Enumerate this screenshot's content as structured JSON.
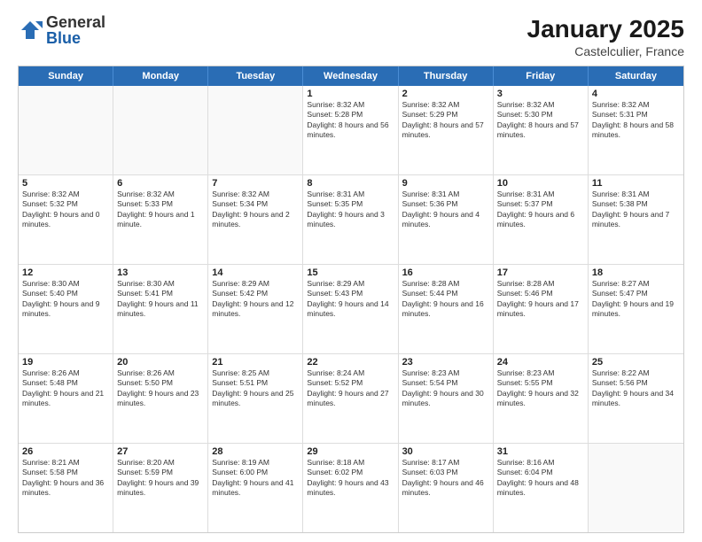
{
  "header": {
    "logo": {
      "general": "General",
      "blue": "Blue"
    },
    "title": "January 2025",
    "location": "Castelculier, France"
  },
  "calendar": {
    "days": [
      "Sunday",
      "Monday",
      "Tuesday",
      "Wednesday",
      "Thursday",
      "Friday",
      "Saturday"
    ],
    "rows": [
      [
        {
          "day": "",
          "empty": true
        },
        {
          "day": "",
          "empty": true
        },
        {
          "day": "",
          "empty": true
        },
        {
          "day": "1",
          "sunrise": "8:32 AM",
          "sunset": "5:28 PM",
          "daylight": "8 hours and 56 minutes."
        },
        {
          "day": "2",
          "sunrise": "8:32 AM",
          "sunset": "5:29 PM",
          "daylight": "8 hours and 57 minutes."
        },
        {
          "day": "3",
          "sunrise": "8:32 AM",
          "sunset": "5:30 PM",
          "daylight": "8 hours and 57 minutes."
        },
        {
          "day": "4",
          "sunrise": "8:32 AM",
          "sunset": "5:31 PM",
          "daylight": "8 hours and 58 minutes."
        }
      ],
      [
        {
          "day": "5",
          "sunrise": "8:32 AM",
          "sunset": "5:32 PM",
          "daylight": "9 hours and 0 minutes."
        },
        {
          "day": "6",
          "sunrise": "8:32 AM",
          "sunset": "5:33 PM",
          "daylight": "9 hours and 1 minute."
        },
        {
          "day": "7",
          "sunrise": "8:32 AM",
          "sunset": "5:34 PM",
          "daylight": "9 hours and 2 minutes."
        },
        {
          "day": "8",
          "sunrise": "8:31 AM",
          "sunset": "5:35 PM",
          "daylight": "9 hours and 3 minutes."
        },
        {
          "day": "9",
          "sunrise": "8:31 AM",
          "sunset": "5:36 PM",
          "daylight": "9 hours and 4 minutes."
        },
        {
          "day": "10",
          "sunrise": "8:31 AM",
          "sunset": "5:37 PM",
          "daylight": "9 hours and 6 minutes."
        },
        {
          "day": "11",
          "sunrise": "8:31 AM",
          "sunset": "5:38 PM",
          "daylight": "9 hours and 7 minutes."
        }
      ],
      [
        {
          "day": "12",
          "sunrise": "8:30 AM",
          "sunset": "5:40 PM",
          "daylight": "9 hours and 9 minutes."
        },
        {
          "day": "13",
          "sunrise": "8:30 AM",
          "sunset": "5:41 PM",
          "daylight": "9 hours and 11 minutes."
        },
        {
          "day": "14",
          "sunrise": "8:29 AM",
          "sunset": "5:42 PM",
          "daylight": "9 hours and 12 minutes."
        },
        {
          "day": "15",
          "sunrise": "8:29 AM",
          "sunset": "5:43 PM",
          "daylight": "9 hours and 14 minutes."
        },
        {
          "day": "16",
          "sunrise": "8:28 AM",
          "sunset": "5:44 PM",
          "daylight": "9 hours and 16 minutes."
        },
        {
          "day": "17",
          "sunrise": "8:28 AM",
          "sunset": "5:46 PM",
          "daylight": "9 hours and 17 minutes."
        },
        {
          "day": "18",
          "sunrise": "8:27 AM",
          "sunset": "5:47 PM",
          "daylight": "9 hours and 19 minutes."
        }
      ],
      [
        {
          "day": "19",
          "sunrise": "8:26 AM",
          "sunset": "5:48 PM",
          "daylight": "9 hours and 21 minutes."
        },
        {
          "day": "20",
          "sunrise": "8:26 AM",
          "sunset": "5:50 PM",
          "daylight": "9 hours and 23 minutes."
        },
        {
          "day": "21",
          "sunrise": "8:25 AM",
          "sunset": "5:51 PM",
          "daylight": "9 hours and 25 minutes."
        },
        {
          "day": "22",
          "sunrise": "8:24 AM",
          "sunset": "5:52 PM",
          "daylight": "9 hours and 27 minutes."
        },
        {
          "day": "23",
          "sunrise": "8:23 AM",
          "sunset": "5:54 PM",
          "daylight": "9 hours and 30 minutes."
        },
        {
          "day": "24",
          "sunrise": "8:23 AM",
          "sunset": "5:55 PM",
          "daylight": "9 hours and 32 minutes."
        },
        {
          "day": "25",
          "sunrise": "8:22 AM",
          "sunset": "5:56 PM",
          "daylight": "9 hours and 34 minutes."
        }
      ],
      [
        {
          "day": "26",
          "sunrise": "8:21 AM",
          "sunset": "5:58 PM",
          "daylight": "9 hours and 36 minutes."
        },
        {
          "day": "27",
          "sunrise": "8:20 AM",
          "sunset": "5:59 PM",
          "daylight": "9 hours and 39 minutes."
        },
        {
          "day": "28",
          "sunrise": "8:19 AM",
          "sunset": "6:00 PM",
          "daylight": "9 hours and 41 minutes."
        },
        {
          "day": "29",
          "sunrise": "8:18 AM",
          "sunset": "6:02 PM",
          "daylight": "9 hours and 43 minutes."
        },
        {
          "day": "30",
          "sunrise": "8:17 AM",
          "sunset": "6:03 PM",
          "daylight": "9 hours and 46 minutes."
        },
        {
          "day": "31",
          "sunrise": "8:16 AM",
          "sunset": "6:04 PM",
          "daylight": "9 hours and 48 minutes."
        },
        {
          "day": "",
          "empty": true
        }
      ]
    ]
  }
}
